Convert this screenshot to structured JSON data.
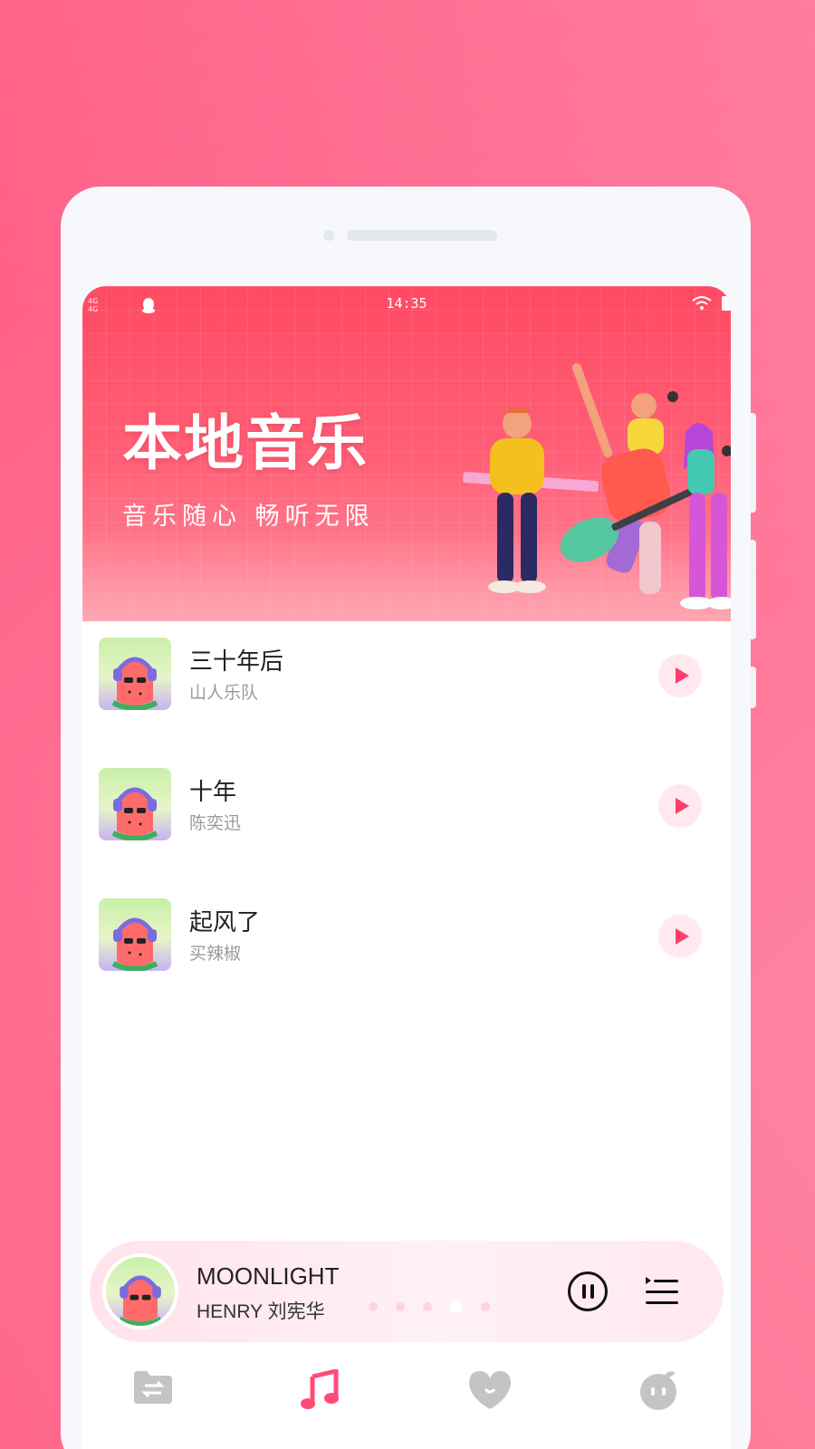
{
  "status_bar": {
    "time": "14:35",
    "signal_line1": "4G",
    "signal_line2": "4G"
  },
  "banner": {
    "title": "本地音乐",
    "subtitle": "音乐随心  畅听无限"
  },
  "songs": [
    {
      "title": "三十年后",
      "artist": "山人乐队"
    },
    {
      "title": "十年",
      "artist": "陈奕迅"
    },
    {
      "title": "起风了",
      "artist": "买辣椒"
    }
  ],
  "now_playing": {
    "title": "MOONLIGHT",
    "artist": "HENRY 刘宪华",
    "page_dots": 5,
    "active_dot": 3
  },
  "tabs": [
    {
      "icon": "folder-transfer-icon"
    },
    {
      "icon": "music-note-icon"
    },
    {
      "icon": "heart-icon"
    },
    {
      "icon": "profile-face-icon"
    }
  ],
  "colors": {
    "accent": "#ff3d6e",
    "banner": "#ff4a63",
    "tab_active": "#ff4b78",
    "tab_inactive": "#c4c4c4"
  }
}
